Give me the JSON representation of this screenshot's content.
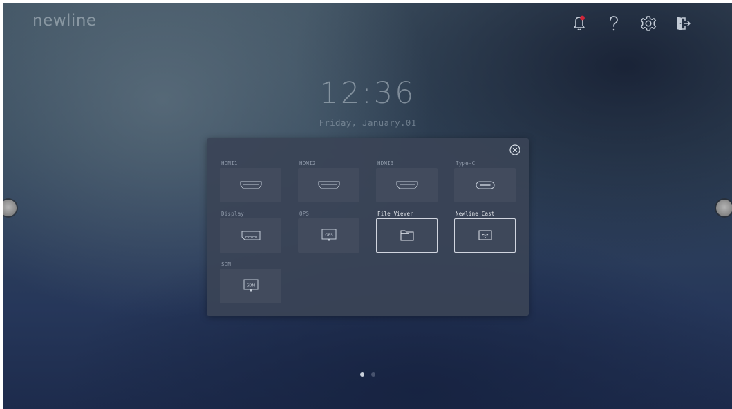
{
  "brand": {
    "logo": "newline"
  },
  "clock": {
    "time": "12:36",
    "date": "Friday, January.01"
  },
  "topbar": {
    "icons": [
      "bell-icon",
      "help-icon",
      "gear-icon",
      "exit-icon"
    ],
    "notification_dot_color": "#d0263a"
  },
  "source_panel": {
    "sources": [
      {
        "label": "HDMI1",
        "icon": "hdmi-port-icon",
        "active": false
      },
      {
        "label": "HDMI2",
        "icon": "hdmi-port-icon",
        "active": false
      },
      {
        "label": "HDMI3",
        "icon": "hdmi-port-icon",
        "active": false
      },
      {
        "label": "Type-C",
        "icon": "usb-c-port-icon",
        "active": false
      },
      {
        "label": "Display",
        "icon": "displayport-icon",
        "active": false
      },
      {
        "label": "OPS",
        "icon": "ops-icon",
        "icon_text": "OPS",
        "active": false
      },
      {
        "label": "File Viewer",
        "icon": "folder-icon",
        "active": true
      },
      {
        "label": "Newline Cast",
        "icon": "cast-icon",
        "active": true
      },
      {
        "label": "SDM",
        "icon": "sdm-icon",
        "icon_text": "SDM",
        "active": false
      }
    ]
  },
  "pager": {
    "pages": 2,
    "current": 1
  },
  "colors": {
    "panel_bg": "#3a4456",
    "tile_bg": "#424c5e",
    "icon_stroke": "#c3cbd6",
    "active_border": "#e1e6ee"
  }
}
